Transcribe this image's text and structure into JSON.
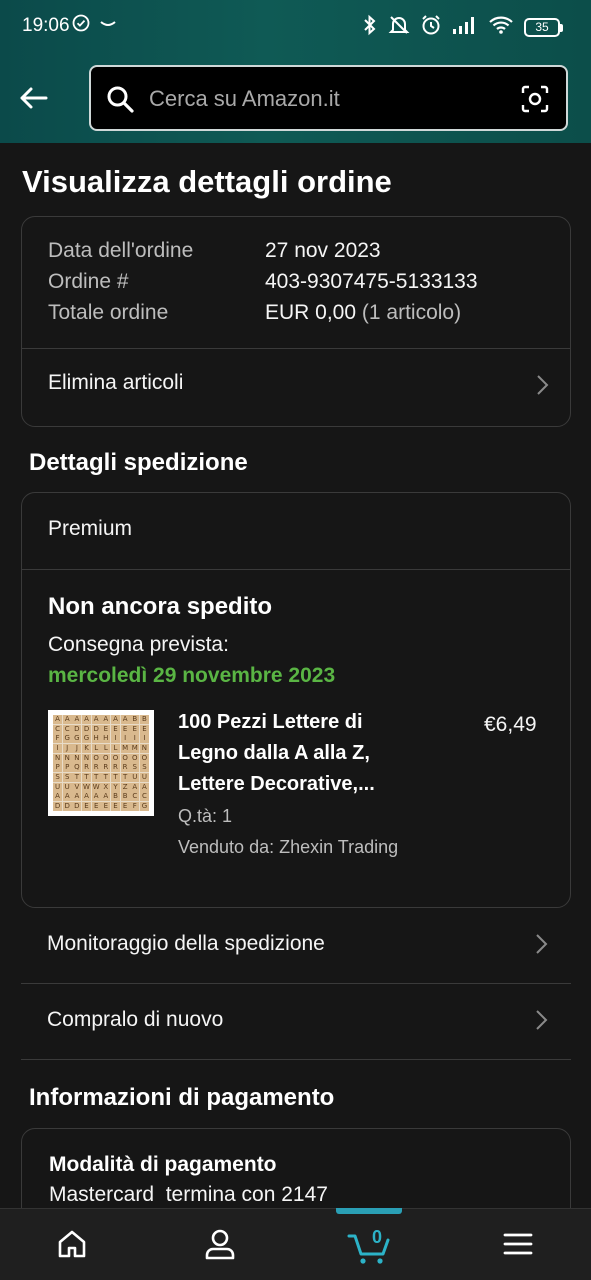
{
  "status_bar": {
    "time": "19:06",
    "battery": "35"
  },
  "search": {
    "placeholder": "Cerca su Amazon.it"
  },
  "page": {
    "title": "Visualizza dettagli ordine"
  },
  "order_summary": {
    "date_label": "Data dell'ordine",
    "date_value": "27 nov 2023",
    "number_label": "Ordine #",
    "number_value": "403-9307475-5133133",
    "total_label": "Totale ordine",
    "total_value": "EUR 0,00",
    "total_items": "(1 articolo)",
    "delete_items": "Elimina articoli"
  },
  "shipping": {
    "heading": "Dettagli spedizione",
    "method": "Premium",
    "status": "Non ancora spedito",
    "delivery_label": "Consegna prevista:",
    "delivery_date": "mercoledì 29 novembre 2023",
    "delivery_date_color": "#5ab544",
    "item": {
      "title": "100 Pezzi Lettere di Legno dalla A alla Z, Lettere Decorative,...",
      "price": "€6,49",
      "quantity": "Q.tà: 1",
      "seller": "Venduto da: Zhexin Trading"
    },
    "track_label": "Monitoraggio della spedizione",
    "buy_again_label": "Compralo di nuovo"
  },
  "payment": {
    "heading": "Informazioni di pagamento",
    "method_label": "Modalità di pagamento",
    "method_value": "Mastercard  termina con 2147"
  },
  "bottom_nav": {
    "items": [
      {
        "icon": "home-icon"
      },
      {
        "icon": "account-icon"
      },
      {
        "icon": "cart-icon",
        "count": "0",
        "active": true
      },
      {
        "icon": "menu-icon"
      }
    ],
    "accent_color": "#2a9fb5"
  }
}
